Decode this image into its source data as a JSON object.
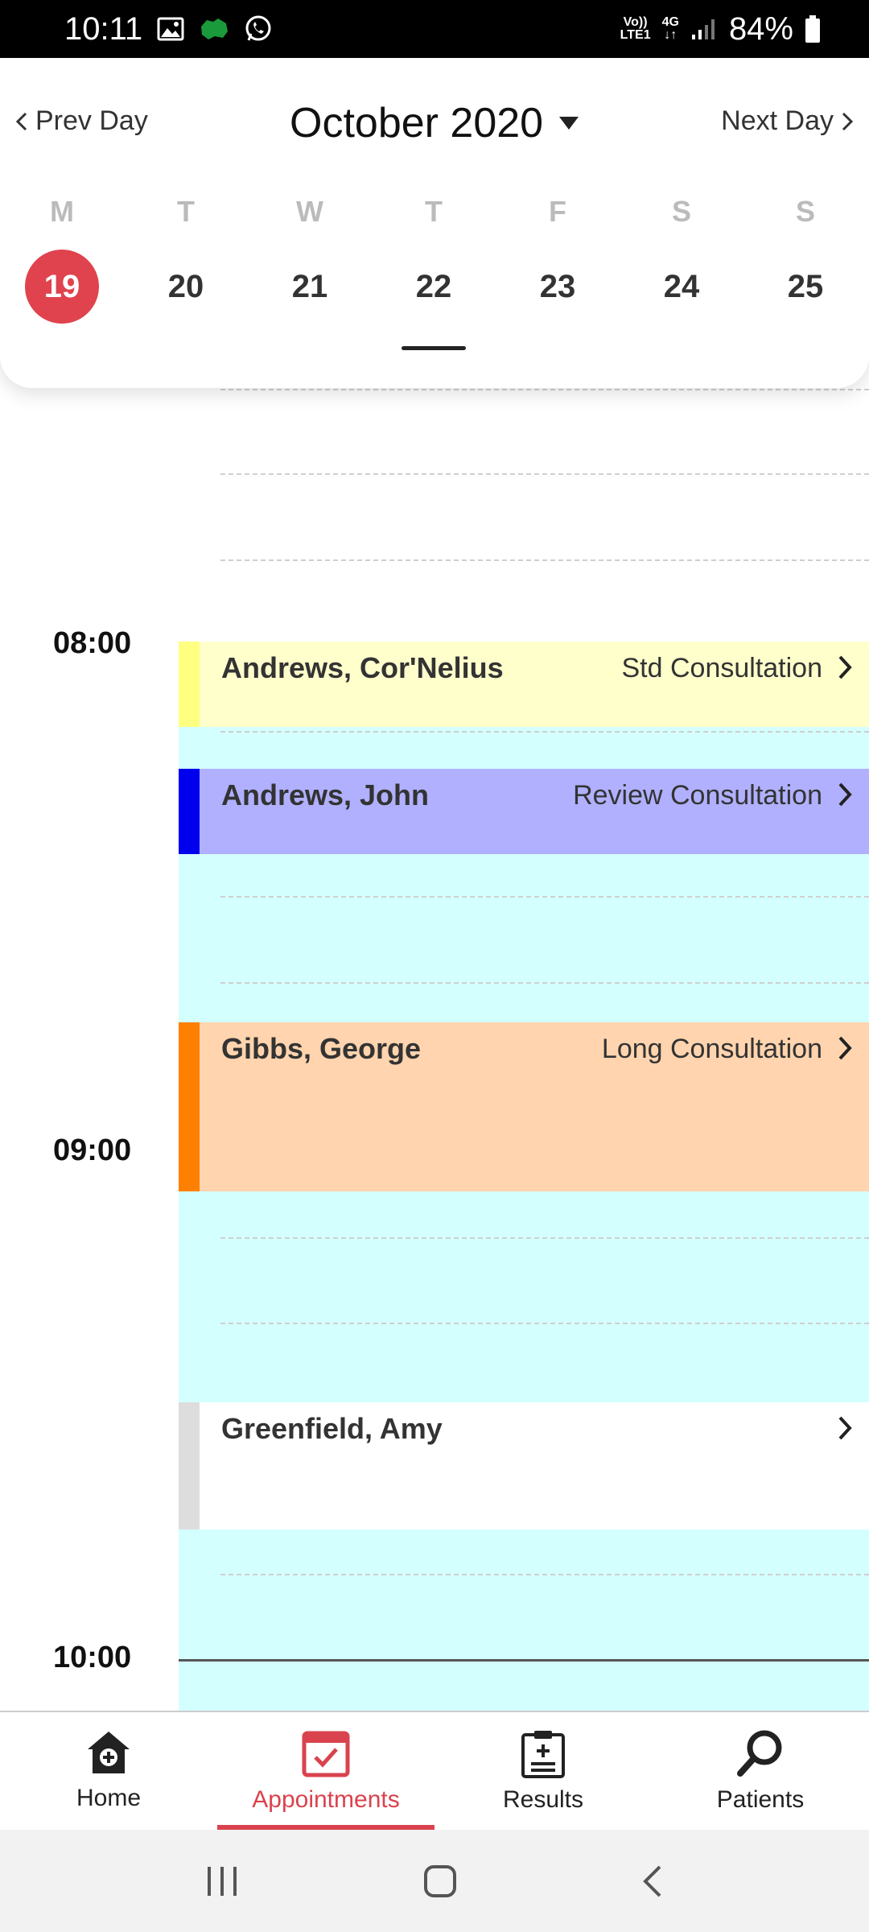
{
  "status_bar": {
    "time": "10:11",
    "net_top": "Vo))",
    "net_bottom": "LTE1",
    "net_4g": "4G",
    "battery": "84%"
  },
  "header": {
    "prev_label": "Prev Day",
    "next_label": "Next Day",
    "month_title": "October 2020",
    "day_letters": [
      "M",
      "T",
      "W",
      "T",
      "F",
      "S",
      "S"
    ],
    "day_numbers": [
      "19",
      "20",
      "21",
      "22",
      "23",
      "24",
      "25"
    ]
  },
  "times": {
    "t0800": "08:00",
    "t0900": "09:00",
    "t1000": "10:00"
  },
  "appointments": [
    {
      "name": "Andrews, Cor'Nelius",
      "type": "Std Consultation",
      "bar_color": "#ffff80",
      "bg_color": "#ffffcc"
    },
    {
      "name": "Andrews, John",
      "type": "Review Consultation",
      "bar_color": "#0000ee",
      "bg_color": "#b0b0ff"
    },
    {
      "name": "Gibbs, George",
      "type": "Long Consultation",
      "bar_color": "#ff8000",
      "bg_color": "#ffd4ae"
    },
    {
      "name": "Greenfield, Amy",
      "type": "",
      "bar_color": "#dddddd",
      "bg_color": "#ffffff"
    }
  ],
  "bottom_nav": {
    "home": "Home",
    "appointments": "Appointments",
    "results": "Results",
    "patients": "Patients"
  },
  "colors": {
    "accent": "#e0434d",
    "free_slot": "#d4ffff"
  }
}
